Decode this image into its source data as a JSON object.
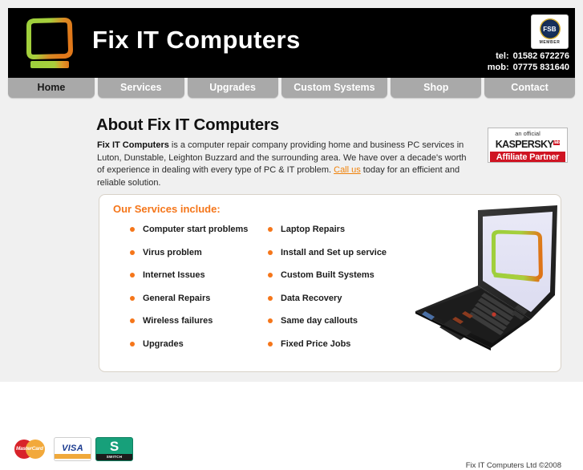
{
  "site": {
    "title": "Fix IT Computers",
    "logo_icon": "monitor-logo-icon"
  },
  "header": {
    "fsb_badge": {
      "seal_text": "FSB",
      "member_text": "MEMBER"
    },
    "contact": {
      "tel_label": "tel:",
      "tel_value": "01582 672276",
      "mob_label": "mob:",
      "mob_value": "07775 831640"
    }
  },
  "nav": {
    "items": [
      {
        "label": "Home",
        "active": true
      },
      {
        "label": "Services",
        "active": false
      },
      {
        "label": "Upgrades",
        "active": false
      },
      {
        "label": "Custom Systems",
        "active": false
      },
      {
        "label": "Shop",
        "active": false
      },
      {
        "label": "Contact",
        "active": false
      }
    ]
  },
  "main": {
    "heading": "About Fix IT Computers",
    "intro": {
      "company_bold": "Fix IT Computers",
      "part1": " is a computer repair company providing home and business PC services in Luton, Dunstable, Leighton Buzzard and the surrounding area. We have over a decade's worth of experience in dealing with every type of PC & IT problem. ",
      "link_text": "Call us",
      "part2": " today for an efficient and reliable solution."
    }
  },
  "kaspersky_badge": {
    "top_line": "an official",
    "brand": "KASPERSKY",
    "lab_suffix": "lab",
    "bottom_line": "Affiliate Partner"
  },
  "services": {
    "heading": "Our Services include:",
    "left_column": [
      "Computer start problems",
      "Virus problem",
      "Internet Issues",
      "General Repairs",
      "Wireless failures",
      "Upgrades"
    ],
    "right_column": [
      "Laptop Repairs",
      "Install and Set up service",
      "Custom Built Systems",
      "Data Recovery",
      "Same day callouts",
      "Fixed Price Jobs"
    ],
    "laptop_image_alt": "laptop-with-logo-image"
  },
  "payments": {
    "mastercard_label": "MasterCard",
    "visa_label": "VISA",
    "switch_label": "SWITCH"
  },
  "footer": {
    "copyright": "Fix IT Computers Ltd ©2008"
  },
  "colors": {
    "accent_orange": "#f5761a",
    "link_orange": "#f0820a",
    "nav_gray": "#a9a9a9",
    "header_black": "#000000",
    "page_gray": "#f0f0f0",
    "kaspersky_red": "#cf1422",
    "logo_green": "#8cc63f",
    "logo_orange": "#e07a1f"
  }
}
